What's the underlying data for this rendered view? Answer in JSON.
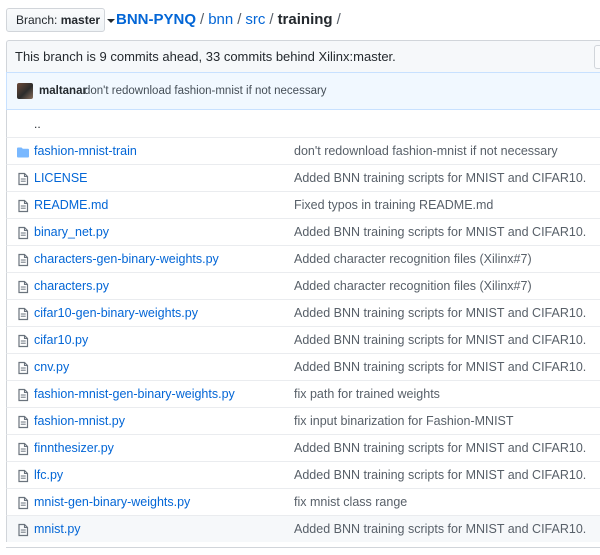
{
  "branch": {
    "label": "Branch:",
    "value": "master"
  },
  "breadcrumb": {
    "repo": "BNN-PYNQ",
    "parts": [
      "bnn",
      "src"
    ],
    "current": "training",
    "separator": "/"
  },
  "branch_info": {
    "text": "This branch is 9 commits ahead, 33 commits behind Xilinx:master."
  },
  "latest_commit": {
    "author": "maltanar",
    "message": "don't redownload fashion-mnist if not necessary"
  },
  "parent_dir": {
    "label": ".."
  },
  "files": [
    {
      "name": "fashion-mnist-train",
      "type": "folder",
      "message": "don't redownload fashion-mnist if not necessary"
    },
    {
      "name": "LICENSE",
      "type": "file",
      "message": "Added BNN training scripts for MNIST and CIFAR10."
    },
    {
      "name": "README.md",
      "type": "file",
      "message": "Fixed typos in training README.md"
    },
    {
      "name": "binary_net.py",
      "type": "file",
      "message": "Added BNN training scripts for MNIST and CIFAR10."
    },
    {
      "name": "characters-gen-binary-weights.py",
      "type": "file",
      "message": "Added character recognition files (Xilinx#7)"
    },
    {
      "name": "characters.py",
      "type": "file",
      "message": "Added character recognition files (Xilinx#7)"
    },
    {
      "name": "cifar10-gen-binary-weights.py",
      "type": "file",
      "message": "Added BNN training scripts for MNIST and CIFAR10."
    },
    {
      "name": "cifar10.py",
      "type": "file",
      "message": "Added BNN training scripts for MNIST and CIFAR10."
    },
    {
      "name": "cnv.py",
      "type": "file",
      "message": "Added BNN training scripts for MNIST and CIFAR10."
    },
    {
      "name": "fashion-mnist-gen-binary-weights.py",
      "type": "file",
      "message": "fix path for trained weights"
    },
    {
      "name": "fashion-mnist.py",
      "type": "file",
      "message": "fix input binarization for Fashion-MNIST"
    },
    {
      "name": "finnthesizer.py",
      "type": "file",
      "message": "Added BNN training scripts for MNIST and CIFAR10."
    },
    {
      "name": "lfc.py",
      "type": "file",
      "message": "Added BNN training scripts for MNIST and CIFAR10."
    },
    {
      "name": "mnist-gen-binary-weights.py",
      "type": "file",
      "message": "fix mnist class range"
    },
    {
      "name": "mnist.py",
      "type": "file",
      "message": "Added BNN training scripts for MNIST and CIFAR10.",
      "highlighted": true
    }
  ],
  "colors": {
    "link": "#0366d6",
    "folder_icon": "#79b8ff",
    "file_icon": "#6a737d",
    "commit_bar": "#f1f8ff"
  }
}
